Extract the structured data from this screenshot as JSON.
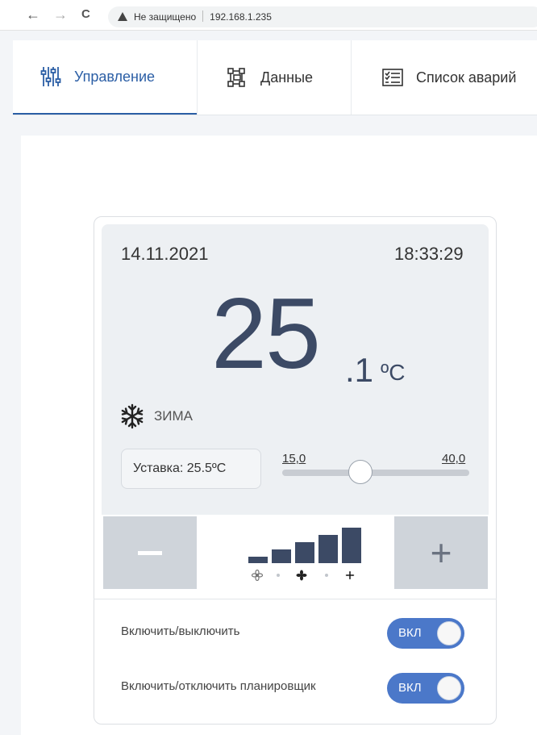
{
  "browser": {
    "back": "←",
    "forward": "→",
    "reload": "C",
    "security_label": "Не защищено",
    "address": "192.168.1.235"
  },
  "tabs": [
    {
      "label": "Управление",
      "icon": "sliders-icon",
      "active": true
    },
    {
      "label": "Данные",
      "icon": "network-icon",
      "active": false
    },
    {
      "label": "Список аварий",
      "icon": "alarm-list-icon",
      "active": false
    }
  ],
  "thermostat": {
    "date": "14.11.2021",
    "time": "18:33:29",
    "temp_integer": "25",
    "temp_decimal": ".1",
    "temp_unit": "ºC",
    "mode_label": "ЗИМА",
    "mode_icon": "snowflake-icon",
    "setpoint_label": "Уставка: 25.5ºC",
    "slider": {
      "min_label": "15,0",
      "max_label": "40,0",
      "min": 15.0,
      "max": 40.0,
      "value": 25.5
    },
    "minus_label": "−",
    "plus_label": "+",
    "fan": {
      "levels": 5,
      "active_level": 5,
      "modes": [
        "fan-low-icon",
        "fan-medium-icon",
        "fan-high-icon"
      ]
    }
  },
  "toggles": [
    {
      "label": "Включить/выключить",
      "state": "ВКЛ",
      "on": true
    },
    {
      "label": "Включить/отключить планировщик",
      "state": "ВКЛ",
      "on": true
    }
  ],
  "colors": {
    "accent": "#2b5ea5",
    "display_bg": "#edf0f3",
    "temp_text": "#3c4a65",
    "toggle_on": "#4b78c9",
    "button_bg": "#cfd4da"
  }
}
